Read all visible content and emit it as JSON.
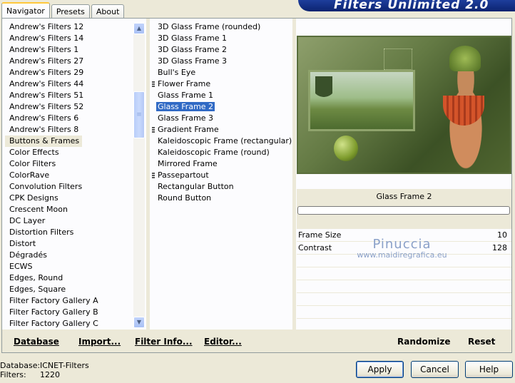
{
  "tabs": [
    "Navigator",
    "Presets",
    "About"
  ],
  "banner_title": "Filters Unlimited 2.0",
  "categories": [
    "Andrew's Filters 12",
    "Andrew's Filters 14",
    "Andrew's Filters 1",
    "Andrew's Filters 27",
    "Andrew's Filters 29",
    "Andrew's Filters 44",
    "Andrew's Filters 51",
    "Andrew's Filters 52",
    "Andrew's Filters 6",
    "Andrew's Filters 8",
    "Buttons & Frames",
    "Color Effects",
    "Color Filters",
    "ColorRave",
    "Convolution Filters",
    "CPK Designs",
    "Crescent Moon",
    "DC Layer",
    "Distortion Filters",
    "Distort",
    "Dégradés",
    "ECWS",
    "Edges, Round",
    "Edges, Square",
    "Filter Factory Gallery A",
    "Filter Factory Gallery B",
    "Filter Factory Gallery C"
  ],
  "filters": [
    "3D Glass Frame (rounded)",
    "3D Glass Frame 1",
    "3D Glass Frame 2",
    "3D Glass Frame 3",
    "Bull's Eye",
    "Flower Frame",
    "Glass Frame 1",
    "Glass Frame 2",
    "Glass Frame 3",
    "Gradient Frame",
    "Kaleidoscopic Frame (rectangular)",
    "Kaleidoscopic Frame (round)",
    "Mirrored Frame",
    "Passepartout",
    "Rectangular Button",
    "Round Button"
  ],
  "selected_filter": "Glass Frame 2",
  "params": [
    {
      "label": "Frame Size",
      "value": "10"
    },
    {
      "label": "Contrast",
      "value": "128"
    }
  ],
  "watermark": {
    "line1": "Pinuccia",
    "line2": "www.maidiregrafica.eu"
  },
  "bottom_buttons": {
    "database": "Database",
    "import": "Import...",
    "filter_info": "Filter Info...",
    "editor": "Editor...",
    "randomize": "Randomize",
    "reset": "Reset"
  },
  "status": {
    "database_label": "Database:",
    "database_value": "ICNET-Filters",
    "filters_label": "Filters:",
    "filters_value": "1220"
  },
  "dialog_buttons": {
    "apply": "Apply",
    "cancel": "Cancel",
    "help": "Help"
  }
}
